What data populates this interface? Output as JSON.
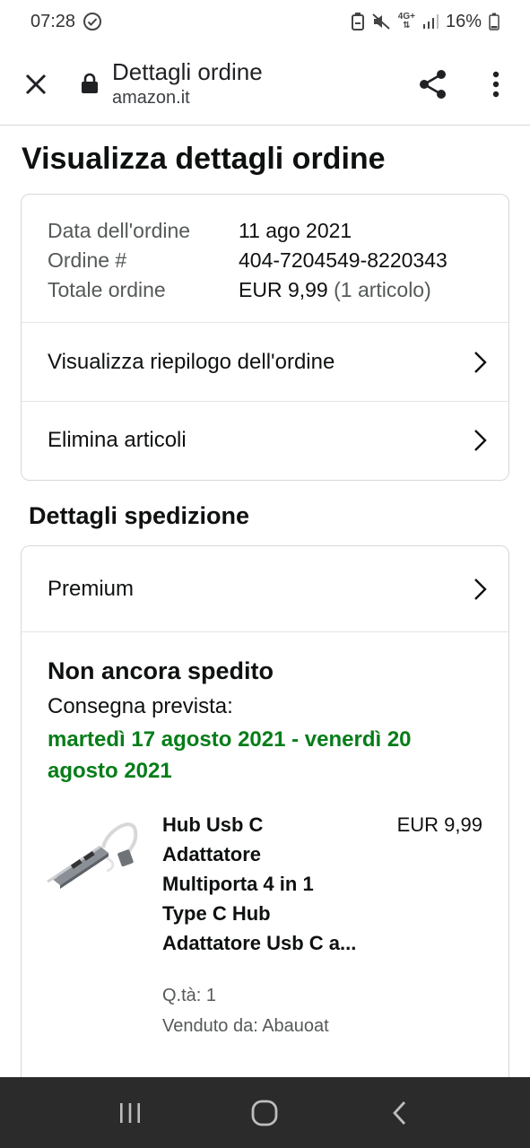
{
  "status_bar": {
    "time": "07:28",
    "battery": "16%",
    "network": "4G+"
  },
  "toolbar": {
    "title": "Dettagli ordine",
    "host": "amazon.it"
  },
  "page": {
    "title": "Visualizza dettagli ordine"
  },
  "order_summary": {
    "rows": [
      {
        "label": "Data dell'ordine",
        "value": "11 ago 2021",
        "extra": ""
      },
      {
        "label": "Ordine #",
        "value": "404-7204549-8220343",
        "extra": ""
      },
      {
        "label": "Totale ordine",
        "value": "EUR 9,99",
        "extra": "(1 articolo)"
      }
    ],
    "links": [
      {
        "label": "Visualizza riepilogo dell'ordine"
      },
      {
        "label": "Elimina articoli"
      }
    ]
  },
  "shipping": {
    "section_title": "Dettagli spedizione",
    "method": "Premium",
    "status": "Non ancora spedito",
    "delivery_label": "Consegna prevista:",
    "delivery_date": "martedì 17 agosto 2021 - venerdì 20 agosto 2021",
    "date_color": "#067d19",
    "item": {
      "title": "Hub Usb C Adattatore Multiporta 4 in 1 Type C Hub Adattatore Usb C a...",
      "price": "EUR 9,99",
      "qty": "Q.tà: 1",
      "seller": "Venduto da: Abauoat"
    }
  },
  "icons": {
    "close": "close-icon",
    "lock": "lock-icon",
    "share": "share-icon",
    "more": "more-vert-icon",
    "chevron": "chevron-right-icon",
    "nav_recents": "recents-icon",
    "nav_home": "home-icon",
    "nav_back": "back-icon"
  }
}
